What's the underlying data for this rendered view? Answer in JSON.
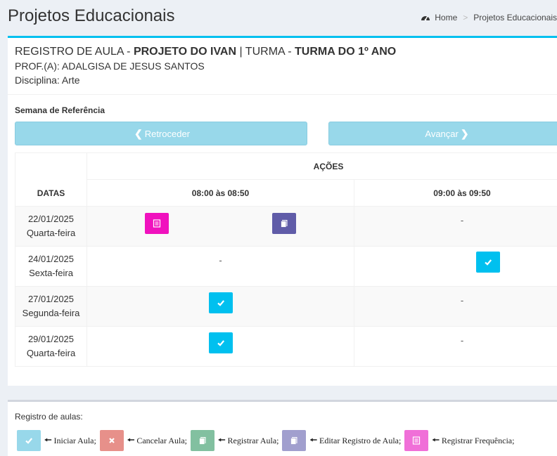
{
  "header": {
    "title": "Projetos Educacionais",
    "breadcrumb": {
      "home": "Home",
      "current": "Projetos Educacionais"
    }
  },
  "info": {
    "prefix1": "REGISTRO DE AULA - ",
    "project": "PROJETO DO IVAN",
    "prefix2": " | TURMA - ",
    "turma": "TURMA DO 1º ANO",
    "professor": "PROF.(A): ADALGISA DE JESUS SANTOS",
    "disciplina": "Disciplina: Arte"
  },
  "week": {
    "label": "Semana de Referência",
    "back_label": "Retroceder",
    "forward_label": "Avançar"
  },
  "table": {
    "dates_header": "DATAS",
    "actions_header": "AÇÕES",
    "slots": [
      "08:00 às 08:50",
      "09:00 às 09:50"
    ],
    "rows": [
      {
        "date": "22/01/2025",
        "weekday": "Quarta-feira",
        "slot2": "-"
      },
      {
        "date": "24/01/2025",
        "weekday": "Sexta-feira",
        "slot1": "-"
      },
      {
        "date": "27/01/2025",
        "weekday": "Segunda-feira",
        "slot2": "-"
      },
      {
        "date": "29/01/2025",
        "weekday": "Quarta-feira",
        "slot2": "-"
      }
    ]
  },
  "legend": {
    "title": "Registro de aulas:",
    "items": [
      {
        "label": "Iniciar Aula;",
        "icon": "check-icon",
        "color": "#98d8ea"
      },
      {
        "label": "Cancelar Aula;",
        "icon": "times-icon",
        "color": "#e7908a"
      },
      {
        "label": "Registrar Aula;",
        "icon": "book-icon",
        "color": "#82c0a0"
      },
      {
        "label": "Editar Registro de Aula;",
        "icon": "book-icon",
        "color": "#a19fce"
      },
      {
        "label": "Registrar Frequência;",
        "icon": "list-icon",
        "color": "#f06fd8"
      }
    ]
  },
  "colors": {
    "accent": "#00c0ef",
    "pink": "#f012be",
    "purple": "#605ca8",
    "aqua": "#00c0ef"
  }
}
